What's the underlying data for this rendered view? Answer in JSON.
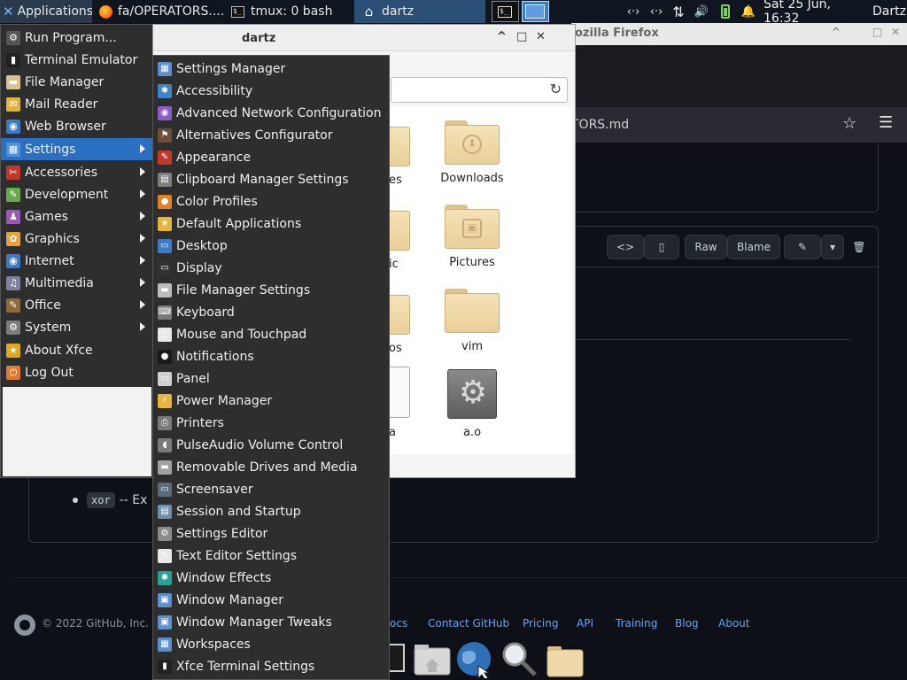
{
  "top_panel": {
    "applications_label": "Applications",
    "windows": [
      {
        "label": "fa/OPERATORS....",
        "icon": "firefox-icon"
      },
      {
        "label": "tmux: 0 bash",
        "icon": "terminal-icon"
      },
      {
        "label": "dartz",
        "icon": "home-folder-icon"
      }
    ],
    "clock": "Sat 25 Jun, 16:32",
    "user": "Dartz",
    "tray_glyphs": {
      "network1": "‹·›",
      "network2": "‹·›",
      "updown": "⇅",
      "volume": "🔊",
      "bell": "🔔"
    }
  },
  "firefox": {
    "title": "ozilla Firefox",
    "url_fragment": "TORS.md",
    "star_glyph": "☆",
    "menu_glyph": "☰"
  },
  "github": {
    "raw_label": "Raw",
    "blame_label": "Blame",
    "xor_code": "xor",
    "xor_text": "-- Ex",
    "copyright": "© 2022 GitHub, Inc.",
    "footer_links": [
      "ocs",
      "Contact GitHub",
      "Pricing",
      "API",
      "Training",
      "Blog",
      "About"
    ]
  },
  "file_manager": {
    "title": "dartz",
    "controls": {
      "min": "^",
      "max": "□",
      "close": "✕"
    },
    "reload_glyph": "↻",
    "items": [
      {
        "label": "Downloads",
        "emblem": "⬇"
      },
      {
        "label": "Pictures",
        "emblem": "▣"
      },
      {
        "label": "vim",
        "emblem": ""
      },
      {
        "label": "a.o",
        "emblem": "⚙"
      }
    ],
    "partial_labels": [
      "es",
      "ic",
      "os",
      "a"
    ]
  },
  "app_menu": {
    "items": [
      {
        "label": "Run Program...",
        "icon": "run-icon",
        "glyph": "⚙",
        "color": "#555555",
        "submenu": false
      },
      {
        "label": "Terminal Emulator",
        "icon": "terminal-icon",
        "glyph": "▮",
        "color": "#222222",
        "submenu": false
      },
      {
        "label": "File Manager",
        "icon": "folder-icon",
        "glyph": "▬",
        "color": "#d9c28f",
        "submenu": false
      },
      {
        "label": "Mail Reader",
        "icon": "mail-icon",
        "glyph": "✉",
        "color": "#e2b33c",
        "submenu": false
      },
      {
        "label": "Web Browser",
        "icon": "globe-icon",
        "glyph": "◉",
        "color": "#3d79c4",
        "submenu": false
      },
      {
        "label": "Settings",
        "icon": "settings-icon",
        "glyph": "▦",
        "color": "#4f8fd6",
        "submenu": true,
        "active": true
      },
      {
        "label": "Accessories",
        "icon": "accessories-icon",
        "glyph": "✂",
        "color": "#c0392b",
        "submenu": true
      },
      {
        "label": "Development",
        "icon": "development-icon",
        "glyph": "✎",
        "color": "#6aa84f",
        "submenu": true
      },
      {
        "label": "Games",
        "icon": "games-icon",
        "glyph": "♟",
        "color": "#9b59b6",
        "submenu": true
      },
      {
        "label": "Graphics",
        "icon": "graphics-icon",
        "glyph": "✿",
        "color": "#e6a23c",
        "submenu": true
      },
      {
        "label": "Internet",
        "icon": "internet-icon",
        "glyph": "◉",
        "color": "#3d79c4",
        "submenu": true
      },
      {
        "label": "Multimedia",
        "icon": "multimedia-icon",
        "glyph": "♫",
        "color": "#7f7f9f",
        "submenu": true
      },
      {
        "label": "Office",
        "icon": "office-icon",
        "glyph": "✎",
        "color": "#8e6b3b",
        "submenu": true
      },
      {
        "label": "System",
        "icon": "system-icon",
        "glyph": "⚙",
        "color": "#7d7d7d",
        "submenu": true
      },
      {
        "label": "About Xfce",
        "icon": "star-icon",
        "glyph": "★",
        "color": "#e0a81c",
        "submenu": false
      },
      {
        "label": "Log Out",
        "icon": "logout-icon",
        "glyph": "⏻",
        "color": "#e07b2c",
        "submenu": false
      }
    ]
  },
  "settings_menu": {
    "items": [
      {
        "label": "Settings Manager",
        "icon": "settings-manager-icon",
        "glyph": "▦",
        "color": "#5b8fd0"
      },
      {
        "label": "Accessibility",
        "icon": "accessibility-icon",
        "glyph": "✱",
        "color": "#3d85c6"
      },
      {
        "label": "Advanced Network Configuration",
        "icon": "network-icon",
        "glyph": "◉",
        "color": "#8e5bc7"
      },
      {
        "label": "Alternatives Configurator",
        "icon": "alternatives-icon",
        "glyph": "⚑",
        "color": "#6b4f3a"
      },
      {
        "label": "Appearance",
        "icon": "appearance-icon",
        "glyph": "✎",
        "color": "#c0392b"
      },
      {
        "label": "Clipboard Manager Settings",
        "icon": "clipboard-icon",
        "glyph": "▤",
        "color": "#7f7f7f"
      },
      {
        "label": "Color Profiles",
        "icon": "color-profiles-icon",
        "glyph": "●",
        "color": "#e67e22"
      },
      {
        "label": "Default Applications",
        "icon": "default-apps-icon",
        "glyph": "★",
        "color": "#e6b53c"
      },
      {
        "label": "Desktop",
        "icon": "desktop-icon",
        "glyph": "▭",
        "color": "#3d79c4"
      },
      {
        "label": "Display",
        "icon": "display-icon",
        "glyph": "▭",
        "color": "#333333"
      },
      {
        "label": "File Manager Settings",
        "icon": "file-manager-settings-icon",
        "glyph": "▬",
        "color": "#bcbcbc"
      },
      {
        "label": "Keyboard",
        "icon": "keyboard-icon",
        "glyph": "⌨",
        "color": "#7a7a7a"
      },
      {
        "label": "Mouse and Touchpad",
        "icon": "mouse-icon",
        "glyph": "▯",
        "color": "#e8e8e8"
      },
      {
        "label": "Notifications",
        "icon": "notifications-icon",
        "glyph": "●",
        "color": "#1a1a1a"
      },
      {
        "label": "Panel",
        "icon": "panel-icon",
        "glyph": "▭",
        "color": "#d0d0d0"
      },
      {
        "label": "Power Manager",
        "icon": "power-icon",
        "glyph": "⚡",
        "color": "#e6b53c"
      },
      {
        "label": "Printers",
        "icon": "printer-icon",
        "glyph": "⎙",
        "color": "#7a7a7a"
      },
      {
        "label": "PulseAudio Volume Control",
        "icon": "speaker-icon",
        "glyph": "◖",
        "color": "#7a7a7a"
      },
      {
        "label": "Removable Drives and Media",
        "icon": "drive-icon",
        "glyph": "▬",
        "color": "#a0a0a0"
      },
      {
        "label": "Screensaver",
        "icon": "screensaver-icon",
        "glyph": "▭",
        "color": "#5a6b7d"
      },
      {
        "label": "Session and Startup",
        "icon": "session-icon",
        "glyph": "▤",
        "color": "#6f8fa8"
      },
      {
        "label": "Settings Editor",
        "icon": "settings-editor-icon",
        "glyph": "⚙",
        "color": "#8a8a8a"
      },
      {
        "label": "Text Editor Settings",
        "icon": "text-editor-icon",
        "glyph": "✎",
        "color": "#e8e8e8"
      },
      {
        "label": "Window Effects",
        "icon": "window-effects-icon",
        "glyph": "✺",
        "color": "#2aa198"
      },
      {
        "label": "Window Manager",
        "icon": "window-manager-icon",
        "glyph": "▣",
        "color": "#5b8fd0"
      },
      {
        "label": "Window Manager Tweaks",
        "icon": "window-tweaks-icon",
        "glyph": "▣",
        "color": "#5b8fd0"
      },
      {
        "label": "Workspaces",
        "icon": "workspaces-icon",
        "glyph": "▦",
        "color": "#5b8fd0"
      },
      {
        "label": "Xfce Terminal Settings",
        "icon": "terminal-settings-icon",
        "glyph": "▮",
        "color": "#222222"
      }
    ]
  }
}
